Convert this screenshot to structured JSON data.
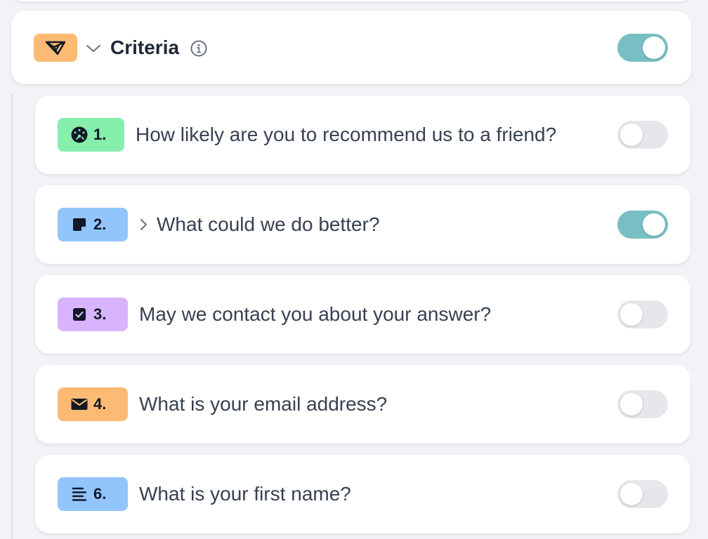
{
  "group": {
    "title": "Criteria",
    "badge_icon": "paper-plane-icon",
    "badge_color": "#fdba74",
    "expanded": true,
    "enabled": true
  },
  "questions": [
    {
      "number": "1.",
      "text": "How likely are you to recommend us to a friend?",
      "icon": "gauge-icon",
      "color": "#86efac",
      "enabled": false,
      "expandable": false
    },
    {
      "number": "2.",
      "text": "What could we do better?",
      "icon": "sticky-note-icon",
      "color": "#93c5fd",
      "enabled": true,
      "expandable": true
    },
    {
      "number": "3.",
      "text": "May we contact you about your answer?",
      "icon": "checkbox-icon",
      "color": "#d8b4fe",
      "enabled": false,
      "expandable": false
    },
    {
      "number": "4.",
      "text": "What is your email address?",
      "icon": "envelope-icon",
      "color": "#fdba74",
      "enabled": false,
      "expandable": false
    },
    {
      "number": "6.",
      "text": "What is your first name?",
      "icon": "text-lines-icon",
      "color": "#93c5fd",
      "enabled": false,
      "expandable": false
    }
  ],
  "colors": {
    "toggle_on": "#78bfc4",
    "toggle_off": "#e5e7eb",
    "background": "#f1f3f6"
  }
}
